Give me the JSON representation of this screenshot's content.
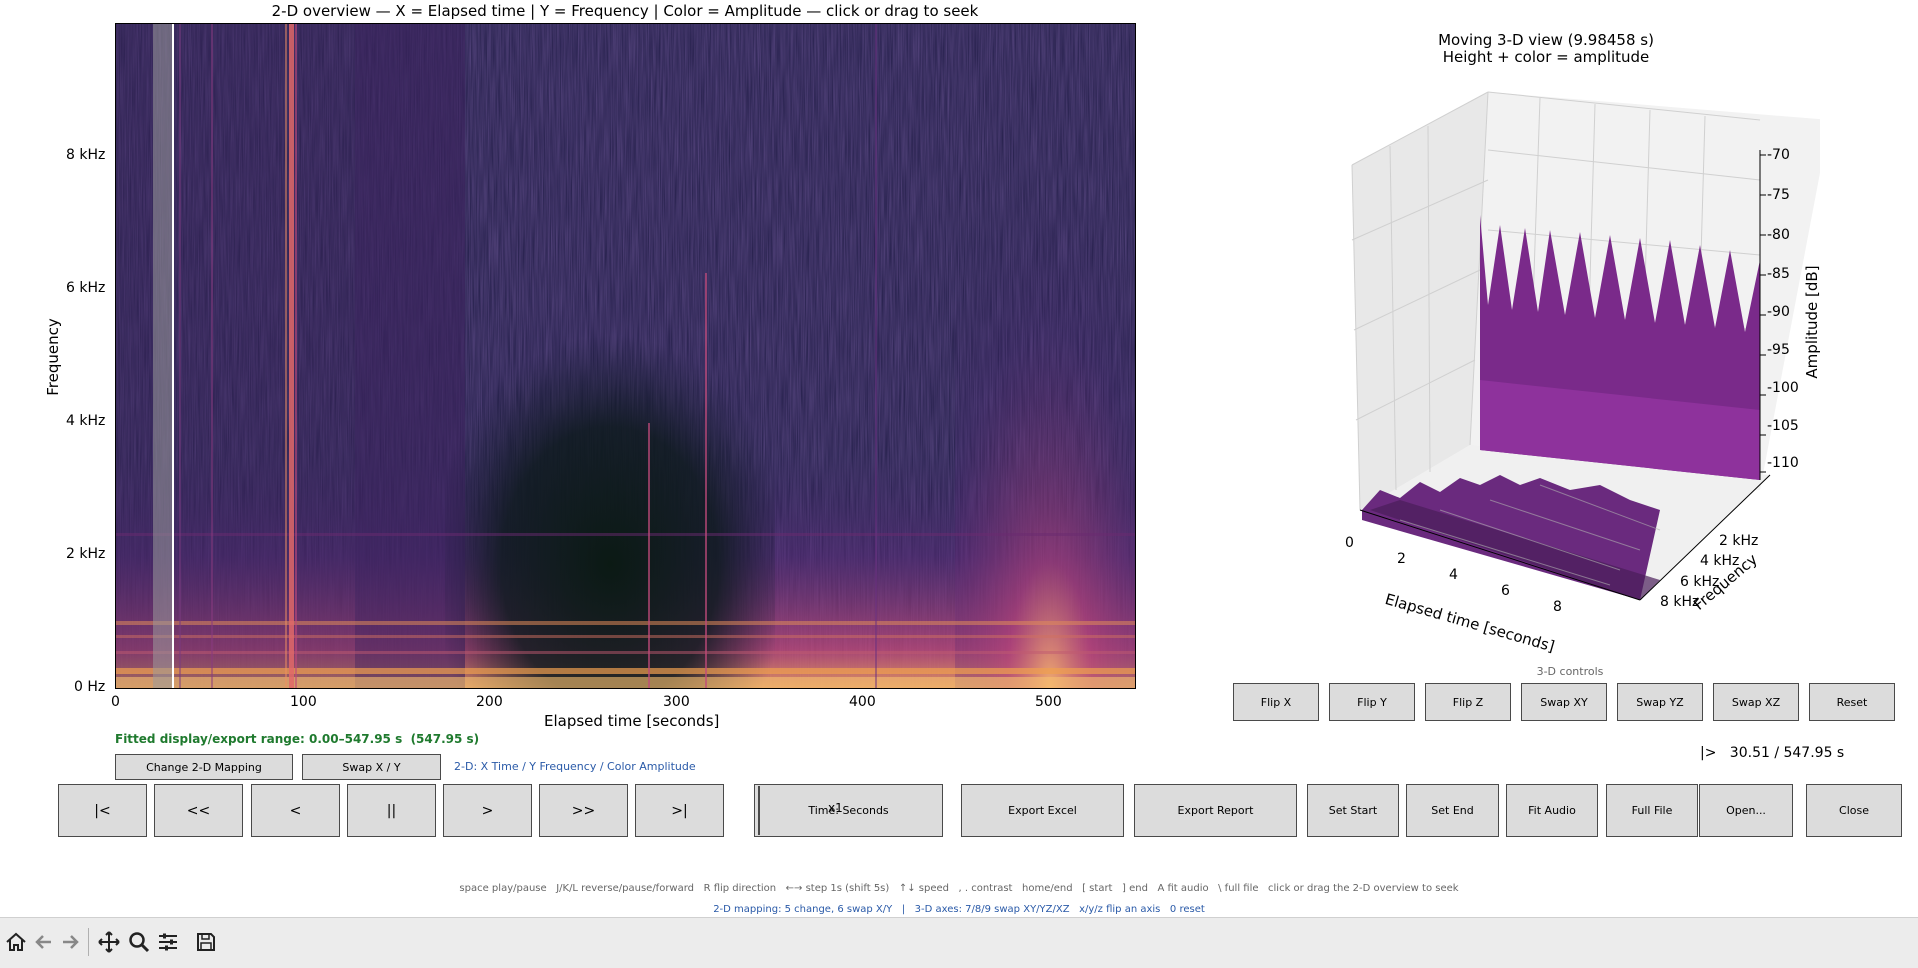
{
  "overview": {
    "title": "2-D overview — X = Elapsed time | Y = Frequency | Color = Amplitude — click or drag to seek",
    "xlabel": "Elapsed time [seconds]",
    "ylabel": "Frequency",
    "xticks": [
      "0",
      "100",
      "200",
      "300",
      "400",
      "500"
    ],
    "yticks": [
      "0 Hz",
      "2 kHz",
      "4 kHz",
      "6 kHz",
      "8 kHz"
    ],
    "fitted_range": "Fitted display/export range: 0.00–547.95 s  (547.95 s)",
    "mapping_status": "2-D: X Time / Y Frequency / Color Amplitude",
    "change_mapping_label": "Change 2-D Mapping",
    "swap_xy_label": "Swap X / Y"
  },
  "view3d": {
    "title_line1": "Moving 3-D view (9.98458 s)",
    "title_line2": "Height + color = amplitude",
    "xlabel": "Elapsed time [seconds]",
    "ylabel": "Frequency",
    "zlabel": "Amplitude [dB]",
    "xticks": [
      "0",
      "2",
      "4",
      "6",
      "8"
    ],
    "yticks": [
      "2 kHz",
      "4 kHz",
      "6 kHz",
      "8 kHz"
    ],
    "zticks": [
      "-70",
      "-75",
      "-80",
      "-85",
      "-90",
      "-95",
      "-100",
      "-105",
      "-110"
    ],
    "controls_title": "3-D controls",
    "controls": [
      "Flip X",
      "Flip Y",
      "Flip Z",
      "Swap XY",
      "Swap YZ",
      "Swap XZ",
      "Reset"
    ]
  },
  "player": {
    "position_readout": "|>   30.51 / 547.95 s",
    "transport": [
      "|<",
      "<<",
      "<",
      "||",
      ">",
      ">>",
      ">|"
    ],
    "speed_label": "x1",
    "time_mode_label": "Time: Seconds",
    "actions": [
      "Export Excel",
      "Export Report",
      "Set Start",
      "Set End",
      "Fit Audio",
      "Full File",
      "Open...",
      "Close"
    ]
  },
  "help": {
    "line1": "space play/pause   J/K/L reverse/pause/forward   R flip direction   ←→ step 1s (shift 5s)   ↑↓ speed   , . contrast   home/end   [ start   ] end   A fit audio   \\ full file   click or drag the 2-D overview to seek",
    "line2": "2-D mapping: 5 change, 6 swap X/Y   |   3-D axes: 7/8/9 swap XY/YZ/XZ   x/y/z flip an axis   0 reset"
  },
  "colors": {
    "green_text": "#1f7a2e",
    "blue_text": "#2a5aa8",
    "help_gray": "#666666",
    "button_bg": "#dcdcdc",
    "spectrogram_bg": "#1e1a44",
    "surface": "#8a2a9a"
  },
  "toolbar_icons": [
    "home-icon",
    "back-arrow-icon",
    "forward-arrow-icon",
    "pan-icon",
    "zoom-icon",
    "configure-icon",
    "save-icon"
  ]
}
